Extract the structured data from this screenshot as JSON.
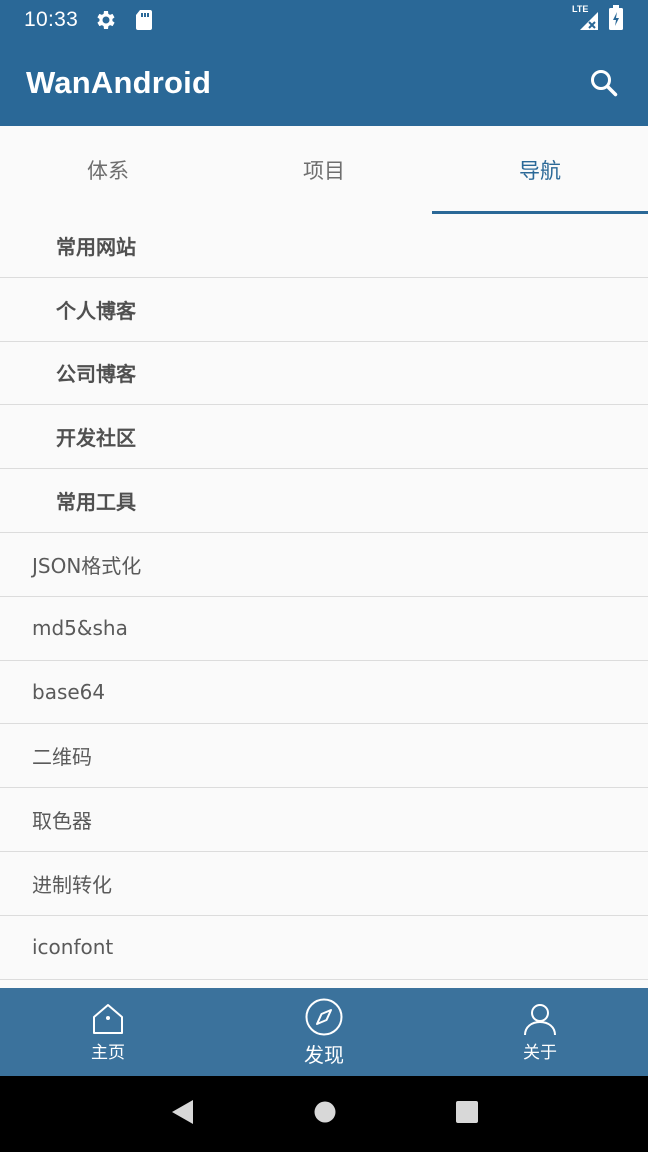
{
  "status_bar": {
    "time": "10:33",
    "network": "LTE"
  },
  "app_bar": {
    "title": "WanAndroid"
  },
  "tabs": [
    {
      "label": "体系",
      "active": false
    },
    {
      "label": "项目",
      "active": false
    },
    {
      "label": "导航",
      "active": true
    }
  ],
  "nav_list": {
    "categories": [
      "常用网站",
      "个人博客",
      "公司博客",
      "开发社区",
      "常用工具"
    ],
    "items": [
      "JSON格式化",
      "md5&sha",
      "base64",
      "二维码",
      "取色器",
      "进制转化",
      "iconfont"
    ]
  },
  "bottom_nav": [
    {
      "label": "主页",
      "icon": "home-icon",
      "active": false
    },
    {
      "label": "发现",
      "icon": "compass-icon",
      "active": true
    },
    {
      "label": "关于",
      "icon": "person-icon",
      "active": false
    }
  ],
  "colors": {
    "primary": "#2a6897",
    "bottom_nav": "#3b729c",
    "divider": "#dcdcdc"
  }
}
